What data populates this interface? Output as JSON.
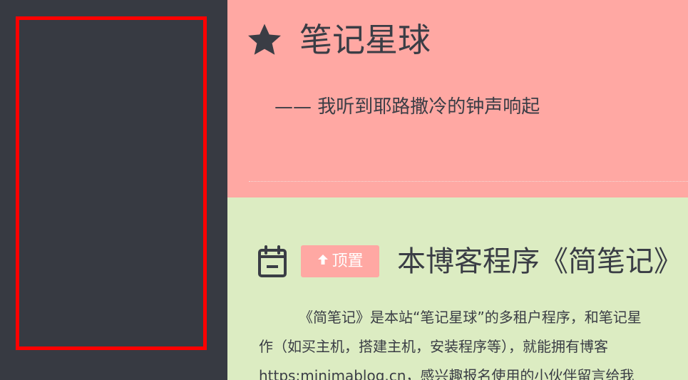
{
  "site": {
    "title": "笔记星球",
    "subtitle": "—— 我听到耶路撒冷的钟声响起",
    "icon": "star-icon"
  },
  "post": {
    "date_icon": "calendar-icon",
    "pin_label": "顶置",
    "pin_icon": "arrow-up-icon",
    "title": "本博客程序《简笔记》",
    "excerpt_lines": [
      "《简笔记》是本站“笔记星球”的多租户程序，和笔记星",
      "作（如买主机，搭建主机，安装程序等），就能拥有博客",
      "https:minimablog.cn，感兴趣报名使用的小伙伴留言给我"
    ]
  },
  "colors": {
    "sidebar_bg": "#373a42",
    "sidebar_frame": "#ff0000",
    "header_bg": "#ffa8a3",
    "content_bg": "#dcecc2",
    "text": "#3a3d45",
    "badge_bg": "#ffa8a3"
  }
}
